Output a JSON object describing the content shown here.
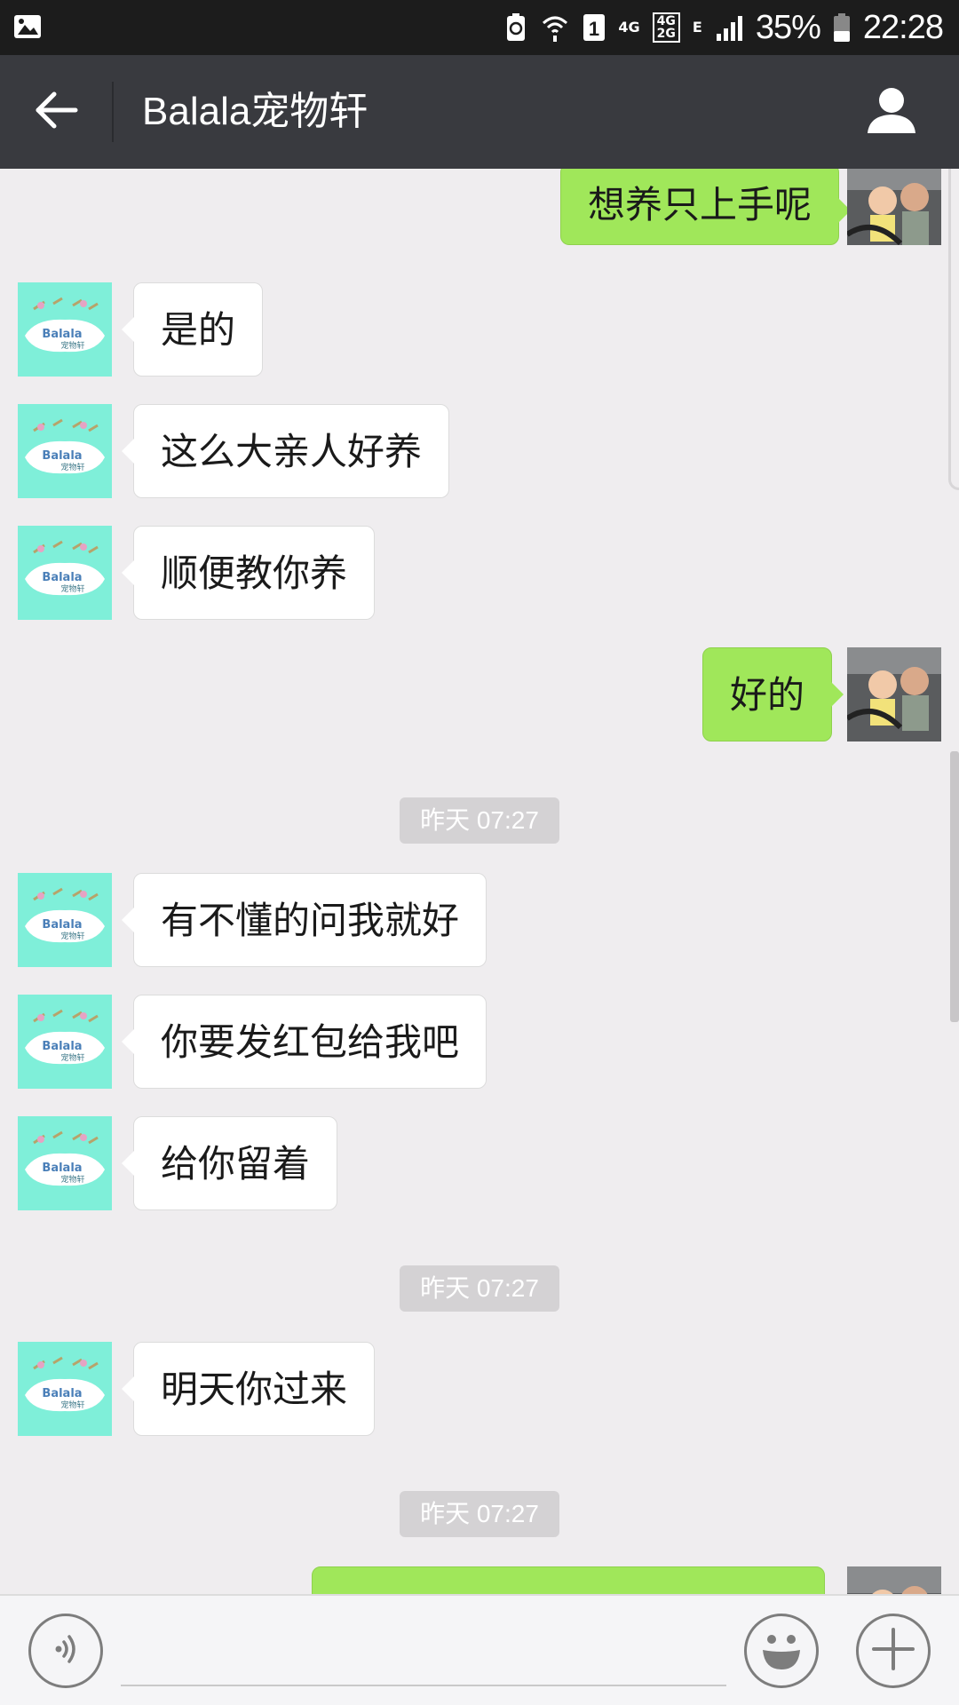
{
  "status_bar": {
    "network_1": "4G",
    "network_2_top": "4G",
    "network_2_bottom": "2G",
    "network_3": "E",
    "sim_slot": "1",
    "battery": "35%",
    "time": "22:28"
  },
  "header": {
    "title": "Balala宠物轩"
  },
  "avatars": {
    "contact_logo_text": "Balala",
    "contact_logo_subtext": "宠物轩"
  },
  "messages": [
    {
      "sender": "me",
      "text": "想养只上手呢"
    },
    {
      "sender": "other",
      "text": "是的"
    },
    {
      "sender": "other",
      "text": "这么大亲人好养"
    },
    {
      "sender": "other",
      "text": "顺便教你养"
    },
    {
      "sender": "me",
      "text": "好的"
    },
    {
      "type": "timestamp",
      "text": "昨天 07:27"
    },
    {
      "sender": "other",
      "text": "有不懂的问我就好"
    },
    {
      "sender": "other",
      "text": "你要发红包给我吧"
    },
    {
      "sender": "other",
      "text": "给你留着"
    },
    {
      "type": "timestamp",
      "text": "昨天 07:27"
    },
    {
      "sender": "other",
      "text": "明天你过来"
    },
    {
      "type": "timestamp",
      "text": "昨天 07:27"
    },
    {
      "sender": "me",
      "text": ""
    }
  ],
  "input_bar": {
    "value": "",
    "placeholder": ""
  },
  "colors": {
    "titlebar": "#393a3f",
    "statusbar": "#1c1c1c",
    "chat_background": "#efedef",
    "my_bubble": "#a0e75a",
    "other_bubble": "#ffffff",
    "contact_avatar": "#7fefd9"
  },
  "icons": {
    "status_left": "image-icon",
    "back": "arrow-left-icon",
    "profile": "person-icon",
    "voice": "voice-icon",
    "emoji": "smiley-icon",
    "more": "plus-icon"
  }
}
